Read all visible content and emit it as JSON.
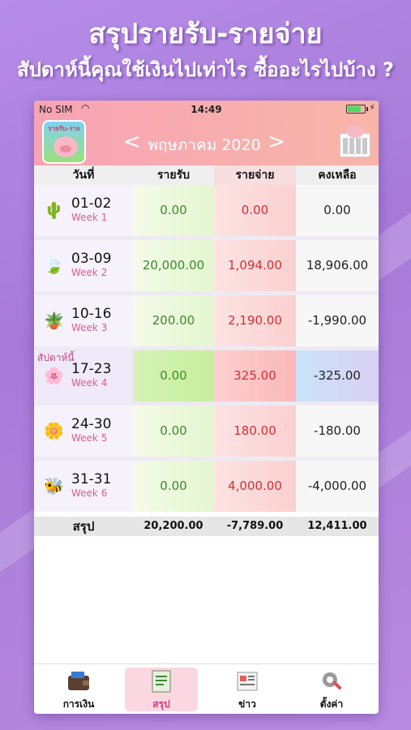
{
  "promo": {
    "title": "สรุปรายรับ-รายจ่าย",
    "subtitle": "สัปดาห์นี้คุณใช้เงินไปเท่าไร ซื้ออะไรไปบ้าง ?"
  },
  "status_bar": {
    "carrier": "No SIM",
    "time": "14:49"
  },
  "app_icon_text": "รายรับ-รายจ่าย",
  "header": {
    "month_label": "พฤษภาคม 2020",
    "prev_arrow": "<",
    "next_arrow": ">"
  },
  "table": {
    "columns": [
      "วันที่",
      "รายรับ",
      "รายจ่าย",
      "คงเหลือ"
    ],
    "this_week_label": "สัปดาห์นี้",
    "rows": [
      {
        "icon": "cactus-icon",
        "glyph": "🌵",
        "range": "01-02",
        "week": "Week 1",
        "income": "0.00",
        "expense": "0.00",
        "balance": "0.00"
      },
      {
        "icon": "leaf-icon",
        "glyph": "🍃",
        "range": "03-09",
        "week": "Week 2",
        "income": "20,000.00",
        "expense": "1,094.00",
        "balance": "18,906.00"
      },
      {
        "icon": "potted-plant-icon",
        "glyph": "🪴",
        "range": "10-16",
        "week": "Week 3",
        "income": "200.00",
        "expense": "2,190.00",
        "balance": "-1,990.00"
      },
      {
        "icon": "cherry-blossom-branch-icon",
        "glyph": "🌸",
        "range": "17-23",
        "week": "Week 4",
        "income": "0.00",
        "expense": "325.00",
        "balance": "-325.00"
      },
      {
        "icon": "flower-icon",
        "glyph": "🌼",
        "range": "24-30",
        "week": "Week 5",
        "income": "0.00",
        "expense": "180.00",
        "balance": "-180.00"
      },
      {
        "icon": "bee-icon",
        "glyph": "🐝",
        "range": "31-31",
        "week": "Week 6",
        "income": "0.00",
        "expense": "4,000.00",
        "balance": "-4,000.00"
      }
    ],
    "summary": {
      "label": "สรุป",
      "income": "20,200.00",
      "expense": "-7,789.00",
      "balance": "12,411.00"
    }
  },
  "tabbar": [
    {
      "name": "tab-finance",
      "icon": "wallet-icon",
      "label": "การเงิน",
      "active": false
    },
    {
      "name": "tab-summary",
      "icon": "report-icon",
      "label": "สรุป",
      "active": true
    },
    {
      "name": "tab-news",
      "icon": "newspaper-icon",
      "label": "ข่าว",
      "active": false
    },
    {
      "name": "tab-settings",
      "icon": "gear-wrench-icon",
      "label": "ตั้งค่า",
      "active": false
    }
  ],
  "colors": {
    "income": "#3c8a2a",
    "expense": "#d32f2f",
    "week_label": "#e05a8e",
    "active_tab_bg": "#fbd7e2"
  }
}
